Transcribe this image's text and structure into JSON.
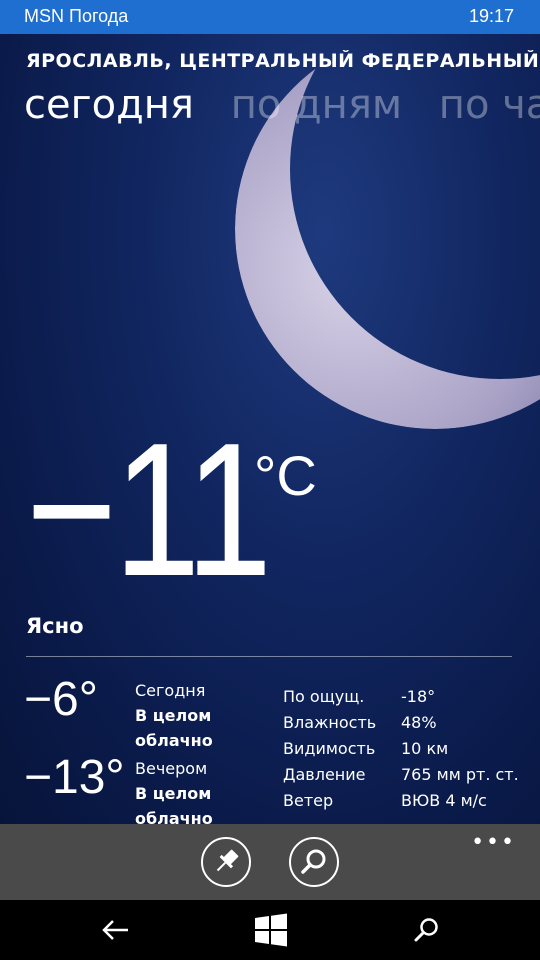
{
  "status_bar": {
    "app_name": "MSN Погода",
    "time": "19:17"
  },
  "header": {
    "location": "ЯРОСЛАВЛЬ, ЦЕНТРАЛЬНЫЙ ФЕДЕРАЛЬНЫЙ ОКРУГ",
    "tabs": [
      {
        "label": "сегодня",
        "active": true
      },
      {
        "label": "по дням",
        "active": false
      },
      {
        "label": "по часам",
        "active": false
      }
    ]
  },
  "current": {
    "temperature": "−11",
    "unit": "°C",
    "condition": "Ясно"
  },
  "forecast": [
    {
      "temp": "−6°",
      "period": "Сегодня",
      "desc_line1": "В целом",
      "desc_line2": "облачно"
    },
    {
      "temp": "−13°",
      "period": "Вечером",
      "desc_line1": "В целом",
      "desc_line2": "облачно"
    }
  ],
  "details": [
    {
      "label": "По ощущ.",
      "value": "-18°"
    },
    {
      "label": "Влажность",
      "value": "48%"
    },
    {
      "label": "Видимость",
      "value": "10 км"
    },
    {
      "label": "Давление",
      "value": "765 мм рт. ст."
    },
    {
      "label": "Ветер",
      "value": "ВЮВ 4 м/с"
    }
  ],
  "app_bar": {
    "buttons": [
      {
        "icon": "pin-icon"
      },
      {
        "icon": "search-icon"
      }
    ],
    "more": "•••"
  },
  "nav_bar": {
    "buttons": [
      "back-arrow-icon",
      "windows-logo-icon",
      "search-icon"
    ]
  },
  "colors": {
    "status_bar": "#1f6fd0",
    "sky": "#0f2258",
    "app_bar": "#4a4a4a",
    "inactive_tab": "#ffffff59"
  }
}
